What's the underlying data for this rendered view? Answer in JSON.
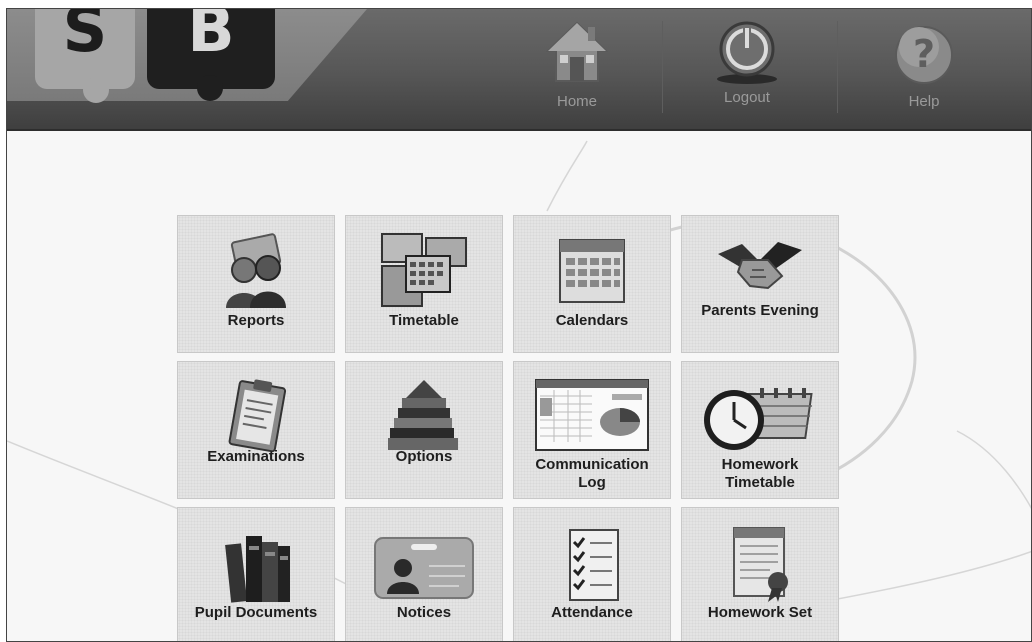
{
  "logo": {
    "letter_1": "S",
    "letter_2": "B"
  },
  "nav": {
    "home": {
      "label": "Home",
      "icon": "house-icon"
    },
    "logout": {
      "label": "Logout",
      "icon": "power-icon"
    },
    "help": {
      "label": "Help",
      "icon": "question-icon"
    }
  },
  "tiles": [
    {
      "label": "Reports",
      "icon": "reports-icon"
    },
    {
      "label": "Timetable",
      "icon": "timetable-icon"
    },
    {
      "label": "Calendars",
      "icon": "calendar-icon"
    },
    {
      "label": "Parents Evening",
      "icon": "handshake-icon"
    },
    {
      "label": "Examinations",
      "icon": "clipboard-icon"
    },
    {
      "label": "Options",
      "icon": "books-stack-icon"
    },
    {
      "label_line1": "Communication",
      "label_line2": "Log",
      "icon": "spreadsheet-icon"
    },
    {
      "label_line1": "Homework",
      "label_line2": "Timetable",
      "icon": "clock-calendar-icon"
    },
    {
      "label": "Pupil Documents",
      "icon": "binders-icon"
    },
    {
      "label": "Notices",
      "icon": "id-card-icon"
    },
    {
      "label": "Attendance",
      "icon": "checklist-icon"
    },
    {
      "label": "Homework Set",
      "icon": "certificate-icon"
    }
  ]
}
